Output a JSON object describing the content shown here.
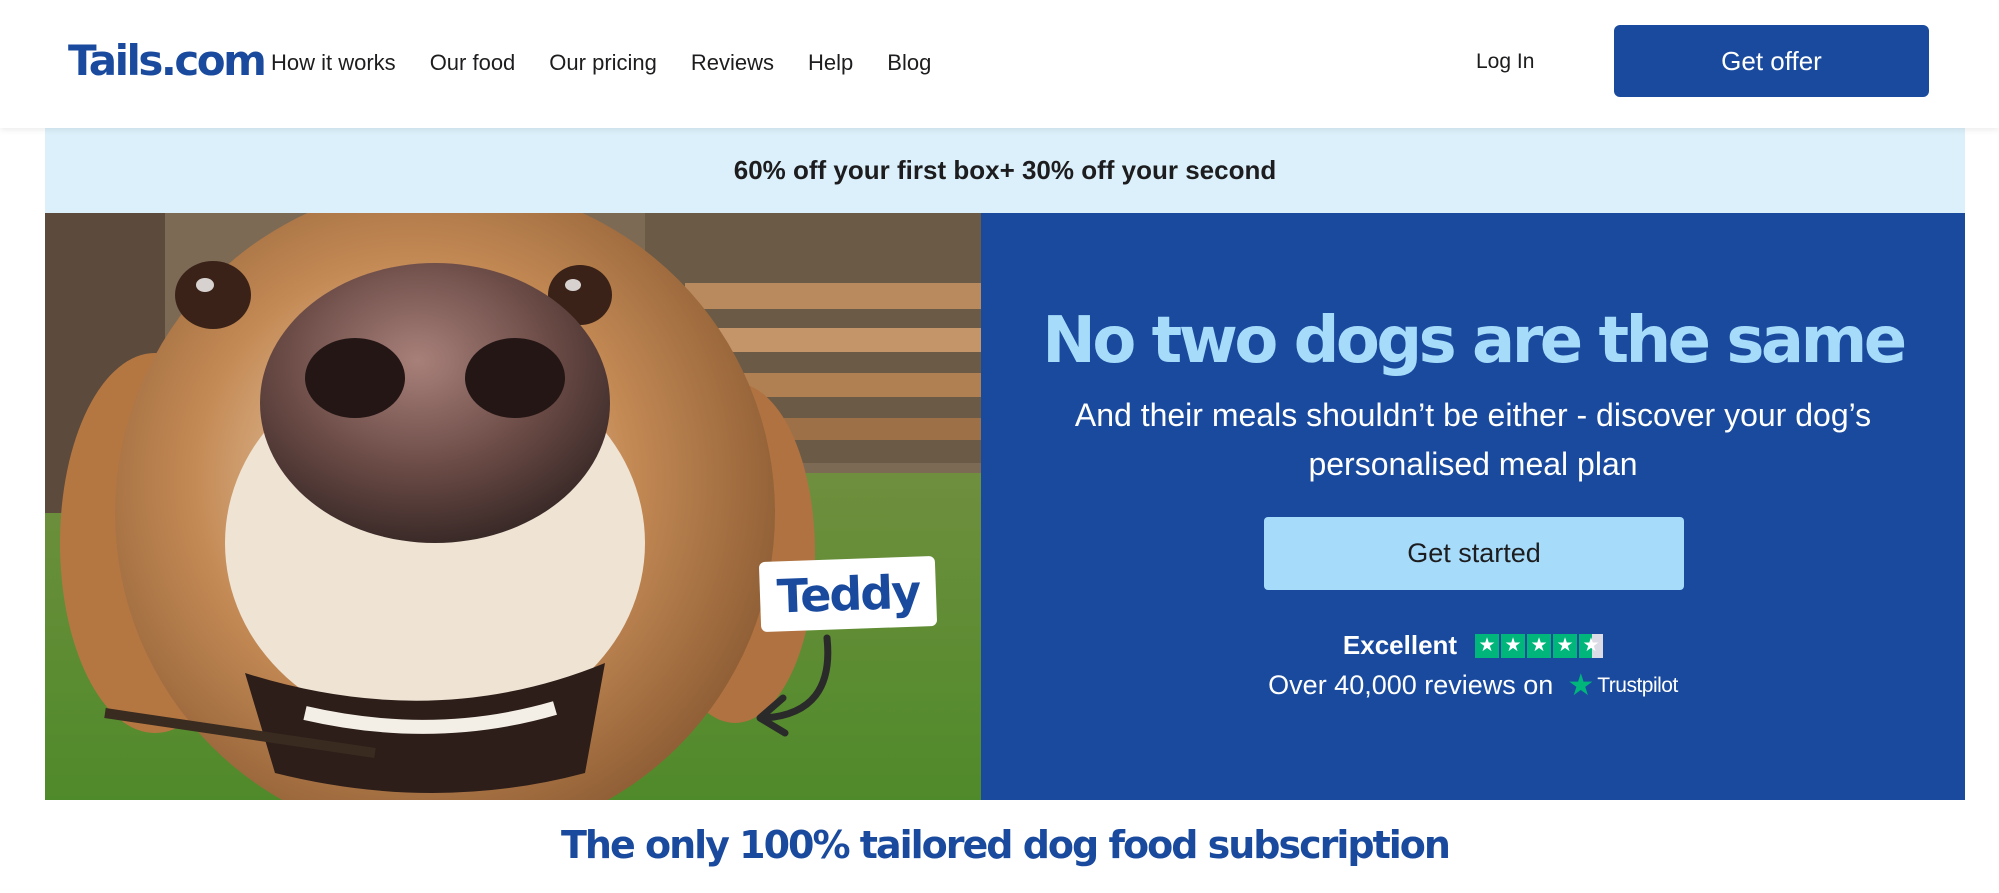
{
  "header": {
    "logo": "Tails.com",
    "nav": [
      "How it works",
      "Our food",
      "Our pricing",
      "Reviews",
      "Help",
      "Blog"
    ],
    "login_label": "Log In",
    "offer_label": "Get offer"
  },
  "promo": {
    "text": "60% off your first box+ 30% off your second"
  },
  "hero": {
    "image_alt": "Close-up of a smiling dog",
    "name_tag": "Teddy",
    "title": "No two dogs are the same",
    "subtitle": "And their meals shouldn’t be either - discover your dog’s personalised meal plan",
    "cta_label": "Get started",
    "rating_label": "Excellent",
    "reviews_text": "Over 40,000 reviews on",
    "trustpilot_label": "Trustpilot",
    "rating_stars": 4.5
  },
  "tagline": "The only 100% tailored dog food subscription",
  "colors": {
    "brand_blue": "#1a4a9e",
    "light_blue": "#a6dcfa",
    "promo_bg": "#dcf0fb",
    "trustpilot_green": "#00b67a"
  }
}
